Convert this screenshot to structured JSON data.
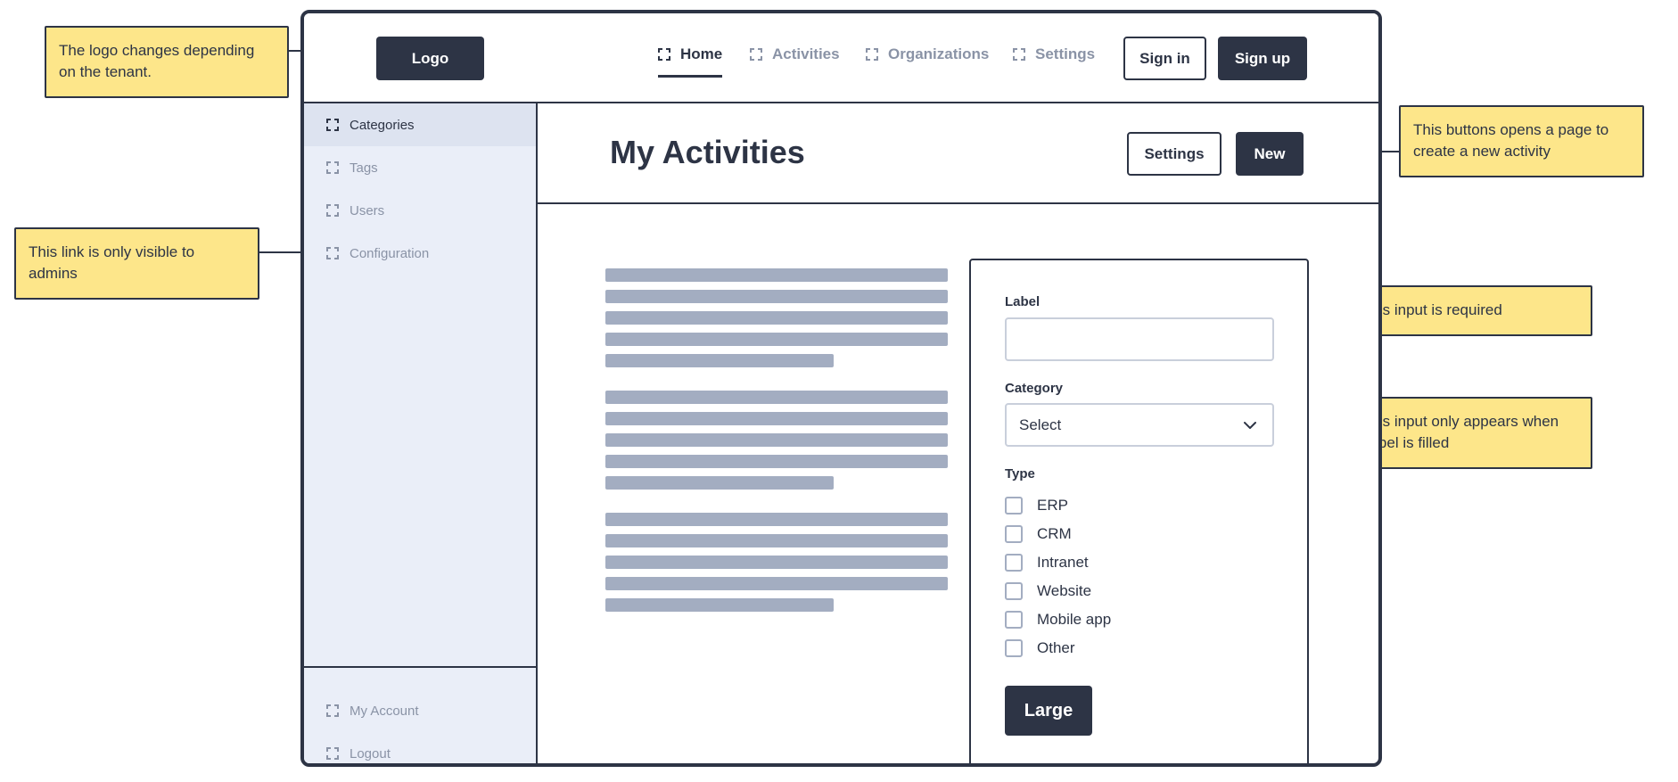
{
  "annotations": {
    "logo": "The logo changes depending on the tenant.",
    "admin_link": "This link is only visible to admins",
    "new_button": "This buttons opens a page to create a new activity",
    "label_required": "This input is required",
    "category_conditional": "This input only appears when Label is filled"
  },
  "header": {
    "logo_label": "Logo",
    "nav": [
      {
        "label": "Home",
        "icon": "expand-icon",
        "active": true
      },
      {
        "label": "Activities",
        "icon": "expand-icon",
        "active": false
      },
      {
        "label": "Organizations",
        "icon": "expand-icon",
        "active": false
      },
      {
        "label": "Settings",
        "icon": "expand-icon",
        "active": false
      }
    ],
    "sign_in": "Sign in",
    "sign_up": "Sign up"
  },
  "sidebar": {
    "items": [
      {
        "label": "Categories",
        "active": true
      },
      {
        "label": "Tags",
        "active": false
      },
      {
        "label": "Users",
        "active": false
      },
      {
        "label": "Configuration",
        "active": false
      }
    ],
    "footer_items": [
      {
        "label": "My Account"
      },
      {
        "label": "Logout"
      }
    ]
  },
  "main": {
    "title": "My Activities",
    "settings_button": "Settings",
    "new_button": "New"
  },
  "form": {
    "label_field": {
      "label": "Label",
      "value": ""
    },
    "category_field": {
      "label": "Category",
      "selected": "Select"
    },
    "type_field": {
      "label": "Type",
      "options": [
        "ERP",
        "CRM",
        "Intranet",
        "Website",
        "Mobile app",
        "Other"
      ]
    },
    "submit_label": "Large"
  },
  "colors": {
    "primary": "#2d3445",
    "muted_text": "#8a93a6",
    "sidebar_bg": "#eaeef8",
    "sidebar_active_bg": "#dde3f0",
    "skeleton": "#a3adc1",
    "note_bg": "#fde68a"
  }
}
